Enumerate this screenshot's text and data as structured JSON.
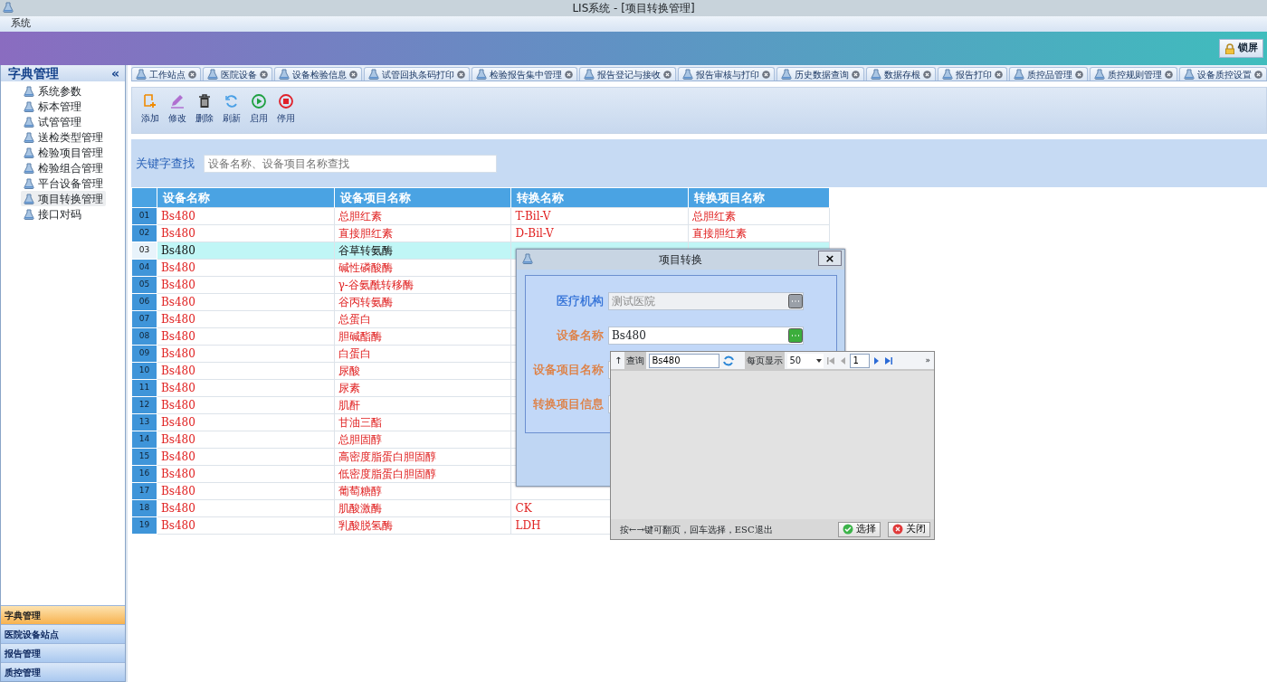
{
  "window": {
    "title": "LIS系统 - [项目转换管理]"
  },
  "menu": [
    "系统"
  ],
  "banner": {
    "lock_button": "锁屏"
  },
  "sidebar": {
    "title": "字典管理",
    "collapse": "«",
    "items": [
      {
        "label": "系统参数",
        "selected": false
      },
      {
        "label": "标本管理",
        "selected": false
      },
      {
        "label": "试管管理",
        "selected": false
      },
      {
        "label": "送检类型管理",
        "selected": false
      },
      {
        "label": "检验项目管理",
        "selected": false
      },
      {
        "label": "检验组合管理",
        "selected": false
      },
      {
        "label": "平台设备管理",
        "selected": false
      },
      {
        "label": "项目转换管理",
        "selected": true
      },
      {
        "label": "接口对码",
        "selected": false
      }
    ],
    "sections": [
      {
        "label": "字典管理",
        "selected": true
      },
      {
        "label": "医院设备站点",
        "selected": false
      },
      {
        "label": "报告管理",
        "selected": false
      },
      {
        "label": "质控管理",
        "selected": false
      }
    ]
  },
  "tabs": [
    "工作站点",
    "医院设备",
    "设备检验信息",
    "试管回执条码打印",
    "检验报告集中管理",
    "报告登记与接收",
    "报告审核与打印",
    "历史数据查询",
    "数据存根",
    "报告打印",
    "质控品管理",
    "质控规则管理",
    "设备质控设置"
  ],
  "toolbar": [
    {
      "label": "添加",
      "kind": "add"
    },
    {
      "label": "修改",
      "kind": "edit"
    },
    {
      "label": "删除",
      "kind": "delete"
    },
    {
      "label": "刷新",
      "kind": "refresh"
    },
    {
      "label": "启用",
      "kind": "start"
    },
    {
      "label": "停用",
      "kind": "stop"
    }
  ],
  "search": {
    "label": "关键字查找",
    "placeholder": "设备名称、设备项目名称查找"
  },
  "table": {
    "columns": [
      "设备名称",
      "设备项目名称",
      "转换名称",
      "转换项目名称"
    ],
    "rows": [
      {
        "num": "01",
        "cells": [
          "Bs480",
          "总胆红素",
          "T-Bil-V",
          "总胆红素"
        ],
        "selected": false
      },
      {
        "num": "02",
        "cells": [
          "Bs480",
          "直接胆红素",
          "D-Bil-V",
          "直接胆红素"
        ],
        "selected": false
      },
      {
        "num": "03",
        "cells": [
          "Bs480",
          "谷草转氨酶"
        ],
        "selected": true
      },
      {
        "num": "04",
        "cells": [
          "Bs480",
          "碱性磷酸酶"
        ],
        "selected": false
      },
      {
        "num": "05",
        "cells": [
          "Bs480",
          "γ-谷氨酰转移酶"
        ],
        "selected": false
      },
      {
        "num": "06",
        "cells": [
          "Bs480",
          "谷丙转氨酶"
        ],
        "selected": false
      },
      {
        "num": "07",
        "cells": [
          "Bs480",
          "总蛋白"
        ],
        "selected": false
      },
      {
        "num": "08",
        "cells": [
          "Bs480",
          "胆碱酯酶"
        ],
        "selected": false
      },
      {
        "num": "09",
        "cells": [
          "Bs480",
          "白蛋白"
        ],
        "selected": false
      },
      {
        "num": "10",
        "cells": [
          "Bs480",
          "尿酸"
        ],
        "selected": false
      },
      {
        "num": "11",
        "cells": [
          "Bs480",
          "尿素"
        ],
        "selected": false
      },
      {
        "num": "12",
        "cells": [
          "Bs480",
          "肌酐"
        ],
        "selected": false
      },
      {
        "num": "13",
        "cells": [
          "Bs480",
          "甘油三酯"
        ],
        "selected": false
      },
      {
        "num": "14",
        "cells": [
          "Bs480",
          "总胆固醇"
        ],
        "selected": false
      },
      {
        "num": "15",
        "cells": [
          "Bs480",
          "高密度脂蛋白胆固醇"
        ],
        "selected": false
      },
      {
        "num": "16",
        "cells": [
          "Bs480",
          "低密度脂蛋白胆固醇"
        ],
        "selected": false
      },
      {
        "num": "17",
        "cells": [
          "Bs480",
          "葡萄糖醇"
        ],
        "selected": false
      },
      {
        "num": "18",
        "cells": [
          "Bs480",
          "肌酸激酶",
          "CK"
        ],
        "selected": false
      },
      {
        "num": "19",
        "cells": [
          "Bs480",
          "乳酸脱氢酶",
          "LDH"
        ],
        "selected": false
      }
    ]
  },
  "dialog": {
    "title": "项目转换",
    "close": "×",
    "fields": [
      {
        "label": "医疗机构",
        "value": "测试医院",
        "disabled": true,
        "color": "#2f6fd6"
      },
      {
        "label": "设备名称",
        "value": "Bs480",
        "disabled": false,
        "color": "#e07b39"
      },
      {
        "label": "设备项目名称",
        "disabled": false,
        "color": "#e07b39"
      },
      {
        "label": "转换项目信息",
        "disabled": false,
        "color": "#e07b39"
      }
    ]
  },
  "picker": {
    "up": "↑",
    "query_label": "查询",
    "query": "Bs480",
    "page_size_label": "每页显示",
    "page_size": "50",
    "page": "1",
    "more": "»",
    "hint": "按←→键可翻页，回车选择，ESC退出",
    "buttons": [
      {
        "label": "选择",
        "kind": "ok"
      },
      {
        "label": "关闭",
        "kind": "close"
      }
    ]
  }
}
